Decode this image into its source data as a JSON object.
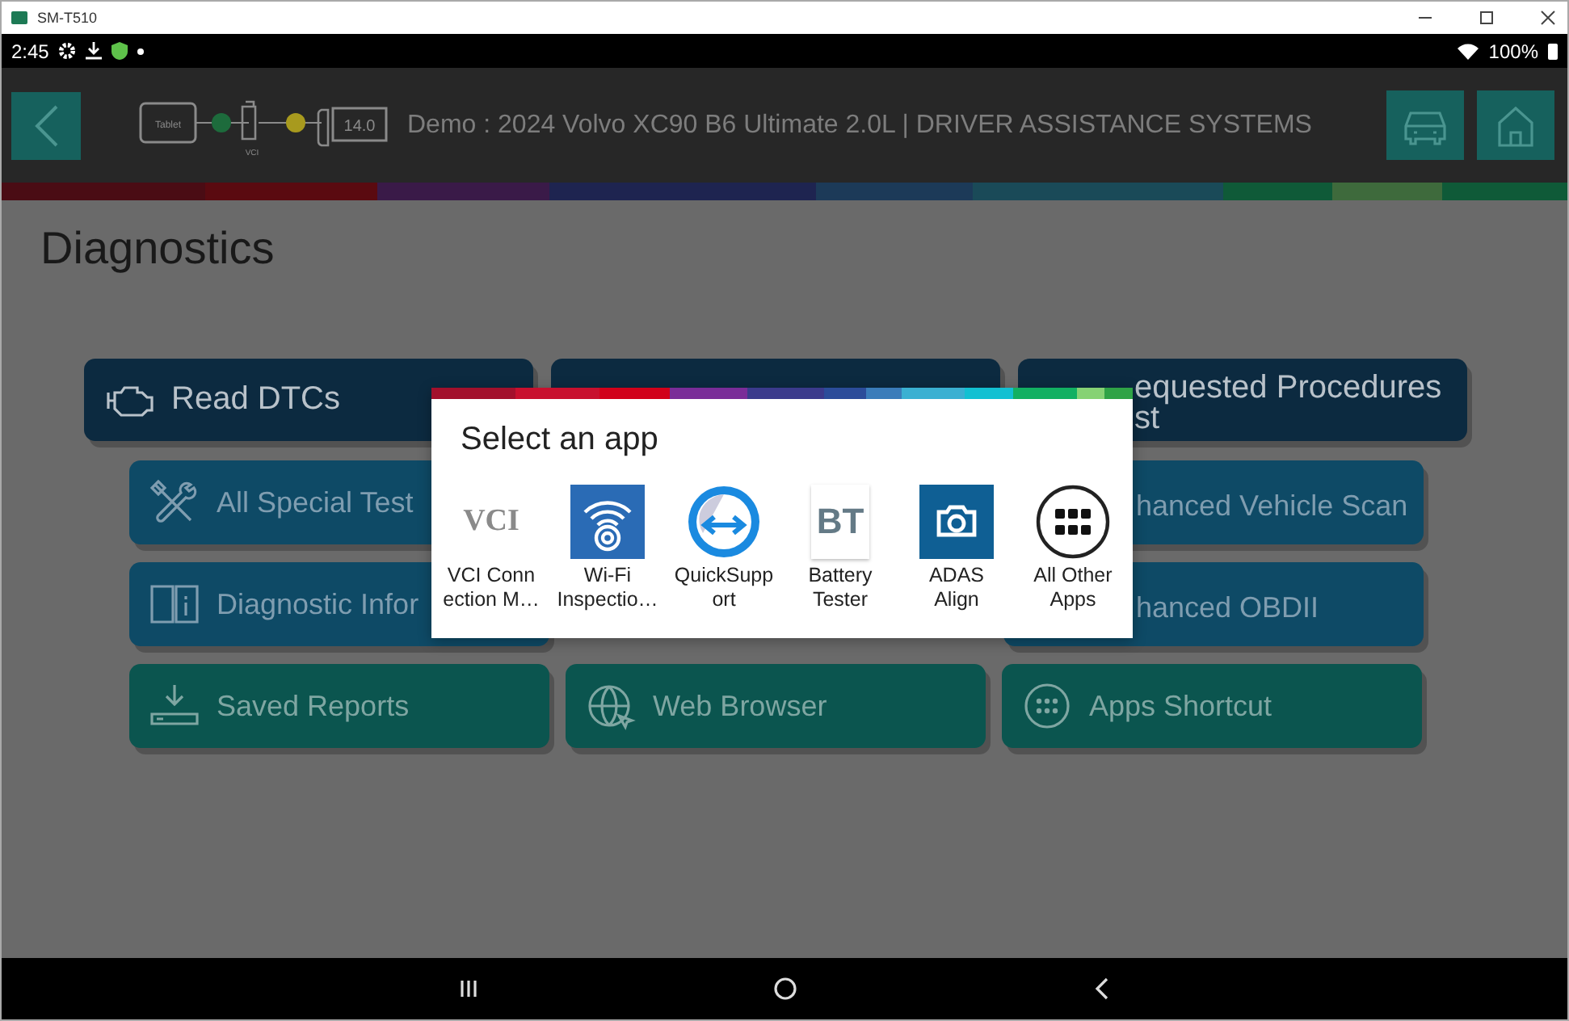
{
  "window": {
    "title": "SM-T510"
  },
  "status_bar": {
    "time": "2:45",
    "battery": "100%"
  },
  "header": {
    "tablet_label": "Tablet",
    "vci_label": "VCI",
    "voltage": "14.0",
    "links": [
      {
        "color": "#1d6b3c"
      },
      {
        "color": "#a89a1e"
      }
    ],
    "title": "Demo : 2024 Volvo XC90 B6 Ultimate 2.0L | DRIVER ASSISTANCE SYSTEMS"
  },
  "page": {
    "title": "Diagnostics"
  },
  "rows": [
    {
      "kind": "primary",
      "buttons": [
        {
          "lines": [
            "Read DTCs"
          ]
        },
        {
          "lines": [
            "equested Procedures",
            "st"
          ]
        }
      ]
    },
    {
      "kind": "secondary",
      "buttons": [
        {
          "lines": [
            "All Special Test"
          ]
        },
        {
          "lines": [
            "hanced Vehicle Scan"
          ]
        }
      ]
    },
    {
      "kind": "secondary",
      "buttons": [
        {
          "lines": [
            "Diagnostic Infor"
          ]
        },
        {
          "lines": [
            "hanced OBDII"
          ]
        }
      ]
    },
    {
      "kind": "tool",
      "buttons": [
        {
          "lines": [
            "Saved Reports"
          ]
        },
        {
          "lines": [
            "Web Browser"
          ]
        },
        {
          "lines": [
            "Apps Shortcut"
          ]
        }
      ]
    }
  ],
  "dialog": {
    "title": "Select an app",
    "apps": [
      {
        "logo": "VCI",
        "lines": [
          "VCI Conn",
          "ection M…"
        ]
      },
      {
        "lines": [
          "Wi-Fi",
          "Inspectio…"
        ]
      },
      {
        "lines": [
          "QuickSupp",
          "ort"
        ]
      },
      {
        "logo": "BT",
        "lines": [
          "Battery",
          "Tester"
        ]
      },
      {
        "lines": [
          "ADAS",
          "Align"
        ]
      },
      {
        "lines": [
          "All Other",
          "Apps"
        ]
      }
    ]
  }
}
